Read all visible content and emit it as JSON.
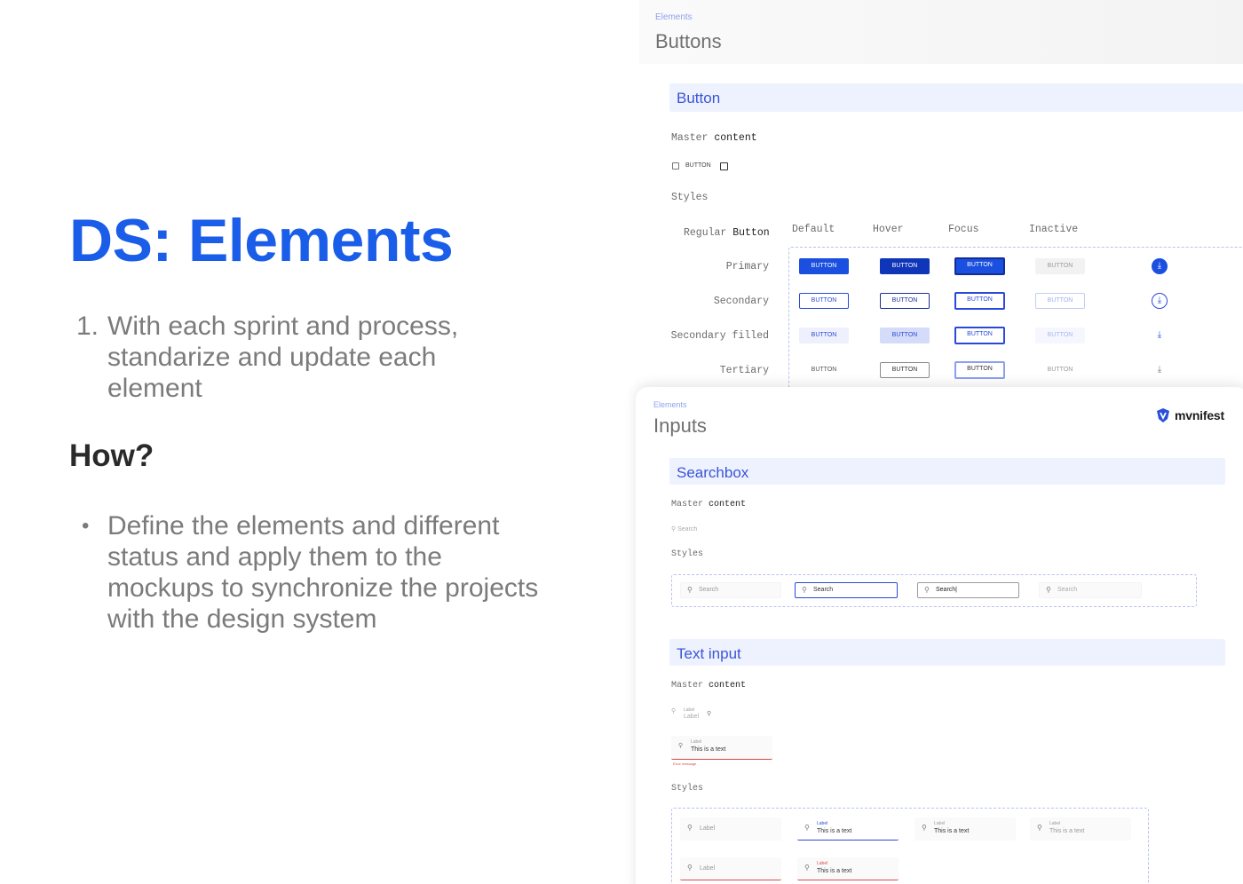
{
  "slide": {
    "title": "DS: Elements",
    "point_number": "1.",
    "point_text": "With each sprint and process, standarize and update each element",
    "how": "How?",
    "bullet_text": "Define the elements and different status and apply them to the mockups to synchronize the projects with the design system"
  },
  "buttons_card": {
    "breadcrumb": "Elements",
    "title": "Buttons",
    "section": "Button",
    "master_content_a": "Master",
    "master_content_b": "content",
    "master_button": "BUTTON",
    "styles": "Styles",
    "regular_a": "Regular",
    "regular_b": "Button",
    "columns": [
      "Default",
      "Hover",
      "Focus",
      "Inactive"
    ],
    "rows": [
      "Primary",
      "Secondary",
      "Secondary filled",
      "Tertiary"
    ],
    "button_label": "BUTTON",
    "download_icon": "download-icon"
  },
  "inputs_card": {
    "breadcrumb": "Elements",
    "title": "Inputs",
    "brand": "mvnifest",
    "searchbox_section": "Searchbox",
    "master_content_a": "Master",
    "master_content_b": "content",
    "search_placeholder": "Search",
    "styles": "Styles",
    "search_states": [
      "Search",
      "Search",
      "Search|",
      "Search"
    ],
    "textinput_section": "Text input",
    "tf_label": "Label",
    "tf_value": "This is a text",
    "error_message": "Error message",
    "accent": "#1a5de9"
  }
}
